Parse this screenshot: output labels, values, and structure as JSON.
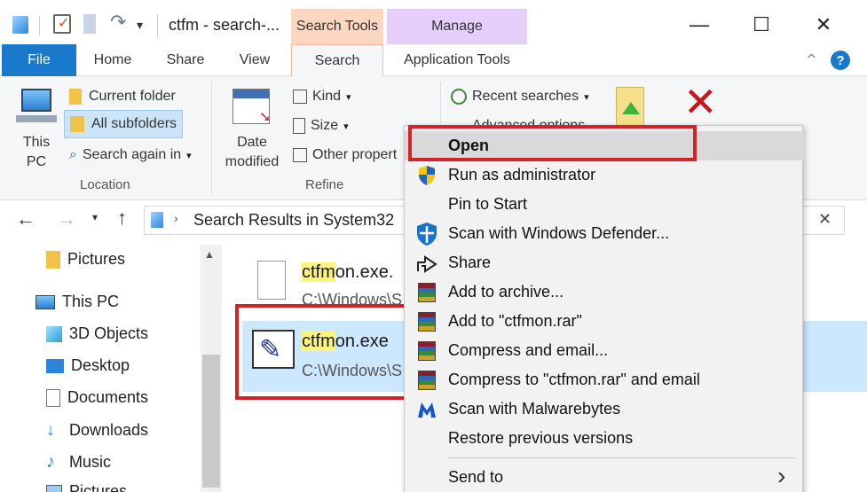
{
  "titlebar": {
    "title": "ctfm - search-...",
    "minimize_glyph": "—",
    "maximize_glyph": "☐",
    "close_glyph": "✕"
  },
  "ribbon_tabs": {
    "file": "File",
    "home": "Home",
    "share": "Share",
    "view": "View",
    "search": "Search",
    "application_tools": "Application Tools",
    "search_tools_header": "Search Tools",
    "manage_header": "Manage",
    "collapse_glyph": "⌃",
    "help_glyph": "?"
  },
  "ribbon": {
    "location": {
      "this_pc": "This PC",
      "current_folder": "Current folder",
      "all_subfolders": "All subfolders",
      "search_again": "Search again in",
      "group_label": "Location"
    },
    "refine": {
      "date_modified": "Date modified",
      "kind": "Kind",
      "size": "Size",
      "other_properties": "Other propert",
      "group_label": "Refine"
    },
    "options": {
      "recent_searches": "Recent searches",
      "advanced_options": "Advanced options"
    }
  },
  "address_bar": {
    "path": "Search Results in System32",
    "clear_glyph": "✕"
  },
  "nav_pane": {
    "items": [
      {
        "label": "Pictures",
        "icon": "folder-icon"
      },
      {
        "label": "This PC",
        "icon": "computer-icon"
      },
      {
        "label": "3D Objects",
        "icon": "cube-icon"
      },
      {
        "label": "Desktop",
        "icon": "desktop-icon"
      },
      {
        "label": "Documents",
        "icon": "documents-icon"
      },
      {
        "label": "Downloads",
        "icon": "downloads-icon"
      },
      {
        "label": "Music",
        "icon": "music-icon"
      },
      {
        "label": "Pictures",
        "icon": "pictures-icon"
      }
    ]
  },
  "results": [
    {
      "name_hl": "ctfm",
      "name_rest": "on.exe.",
      "path": "C:\\Windows\\S"
    },
    {
      "name_hl": "ctfm",
      "name_rest": "on.exe",
      "path": "C:\\Windows\\S"
    }
  ],
  "context_menu": {
    "items": [
      {
        "label": "Open",
        "icon": "none"
      },
      {
        "label": "Run as administrator",
        "icon": "uac-shield-icon"
      },
      {
        "label": "Pin to Start",
        "icon": "none"
      },
      {
        "label": "Scan with Windows Defender...",
        "icon": "defender-icon"
      },
      {
        "label": "Share",
        "icon": "share-icon"
      },
      {
        "label": "Add to archive...",
        "icon": "winrar-icon"
      },
      {
        "label": "Add to \"ctfmon.rar\"",
        "icon": "winrar-icon"
      },
      {
        "label": "Compress and email...",
        "icon": "winrar-icon"
      },
      {
        "label": "Compress to \"ctfmon.rar\" and email",
        "icon": "winrar-icon"
      },
      {
        "label": "Scan with Malwarebytes",
        "icon": "malwarebytes-icon"
      },
      {
        "label": "Restore previous versions",
        "icon": "none"
      },
      {
        "label": "Send to",
        "icon": "none"
      }
    ],
    "submenu_glyph": "›"
  },
  "colors": {
    "file_tab": "#1979ca",
    "search_tools": "#fbd7c1",
    "manage": "#e6cffb",
    "annotation_red": "#d32228",
    "selection": "#cce8ff",
    "search_highlight": "#fdf57a"
  }
}
